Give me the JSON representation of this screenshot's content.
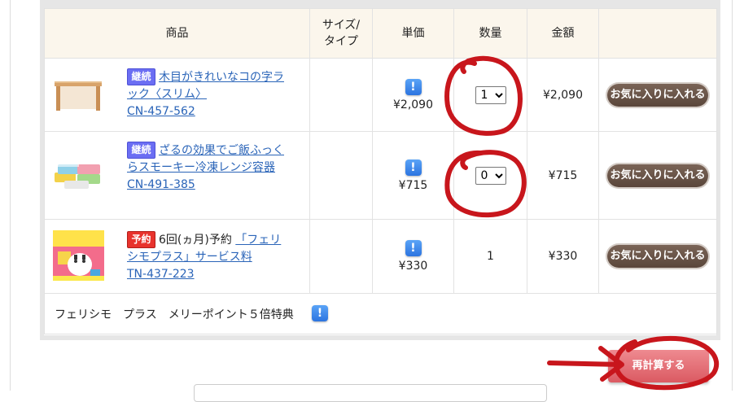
{
  "table": {
    "headers": {
      "product": "商品",
      "size_type_line1": "サイズ/",
      "size_type_line2": "タイプ",
      "unit_price": "単価",
      "quantity": "数量",
      "amount": "金額"
    },
    "rows": [
      {
        "badge": "継続",
        "name": "木目がきれいなコの字ラック〈スリム〉",
        "code": "CN-457-562",
        "unit_price": "¥2,090",
        "quantity": "1",
        "amount": "¥2,090",
        "fav_label": "お気に入りに入れる"
      },
      {
        "badge": "継続",
        "name": "ざるの効果でご飯ふっくらスモーキー冷凍レンジ容器",
        "code": "CN-491-385",
        "unit_price": "¥715",
        "quantity": "0",
        "amount": "¥715",
        "fav_label": "お気に入りに入れる"
      },
      {
        "badge": "予約",
        "prefix": "6回(ヵ月)予約",
        "name": "「フェリシモプラス」サービス料",
        "code": "TN-437-223",
        "unit_price": "¥330",
        "quantity": "1",
        "amount": "¥330",
        "fav_label": "お気に入りに入れる",
        "thumb_text": "フェリシモプラス"
      }
    ],
    "special": "フェリシモ　プラス　メリーポイント５倍特典"
  },
  "info_icon_glyph": "!",
  "recalc_label": "再計算する",
  "colors": {
    "header_bg": "#fbf6ec",
    "link": "#2a64b8",
    "fav_button": "#5a463b",
    "recalc_button": "#db5a62",
    "annotation": "#c8161c"
  }
}
